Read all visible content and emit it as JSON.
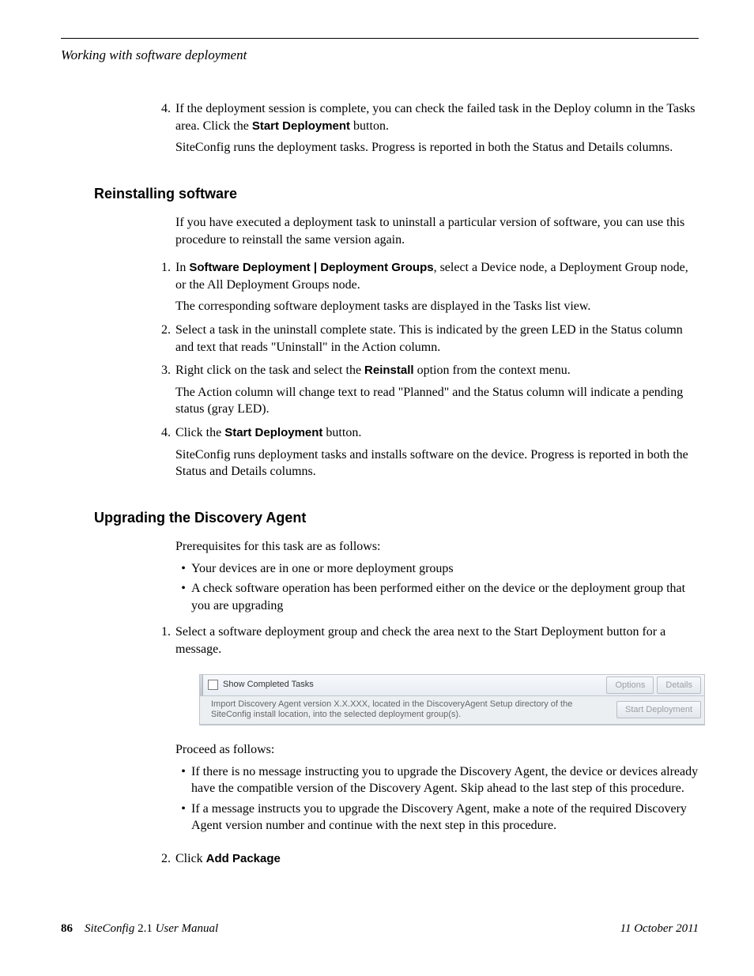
{
  "header": {
    "running_title": "Working with software deployment"
  },
  "section_a": {
    "step4_main": "If the deployment session is complete, you can check the failed task in the Deploy column in the Tasks area. Click the ",
    "step4_btn": "Start Deployment",
    "step4_tail": " button.",
    "step4_sub": "SiteConfig runs the deployment tasks. Progress is reported in both the Status and Details columns."
  },
  "reinstall": {
    "heading": "Reinstalling software",
    "intro": "If you have executed a deployment task to uninstall a particular version of software, you can use this procedure to reinstall the same version again.",
    "s1_pre": "In ",
    "s1_path": "Software Deployment | Deployment Groups",
    "s1_post": ", select a Device node, a Deployment Group node, or the All Deployment Groups node.",
    "s1_sub": "The corresponding software deployment tasks are displayed in the Tasks list view.",
    "s2": "Select a task in the uninstall complete state. This is indicated by the green LED in the Status column and text that reads \"Uninstall\" in the Action column.",
    "s3_pre": "Right click on the task and select the ",
    "s3_opt": "Reinstall",
    "s3_post": " option from the context menu.",
    "s3_sub": "The Action column will change text to read \"Planned\" and the Status column will indicate a pending status (gray LED).",
    "s4_pre": "Click the ",
    "s4_btn": "Start Deployment",
    "s4_post": " button.",
    "s4_sub": "SiteConfig runs deployment tasks and installs software on the device. Progress is reported in both the Status and Details columns."
  },
  "upgrade": {
    "heading": "Upgrading the Discovery Agent",
    "intro": "Prerequisites for this task are as follows:",
    "pre_b1": "Your devices are in one or more deployment groups",
    "pre_b2": "A check software operation has been performed either on the device or the deployment group that you are upgrading",
    "s1": "Select a software deployment group and check the area next to the Start Deployment button for a message.",
    "panel": {
      "show_completed": "Show Completed Tasks",
      "options": "Options",
      "details": "Details",
      "msg": "Import Discovery Agent version X.X.XXX, located in the DiscoveryAgent Setup directory of the SiteConfig install location, into the selected deployment group(s).",
      "start": "Start Deployment"
    },
    "proceed": "Proceed as follows:",
    "post_b1": "If there is no message instructing you to upgrade the Discovery Agent, the device or devices already have the compatible version of the Discovery Agent. Skip ahead to the last step of this procedure.",
    "post_b2": "If a message instructs you to upgrade the Discovery Agent, make a note of the required Discovery Agent version number and continue with the next step in this procedure.",
    "s2_pre": "Click ",
    "s2_btn": "Add Package"
  },
  "footer": {
    "page_number": "86",
    "product": "SiteConfig",
    "version": " 2.1 ",
    "doc": "User Manual",
    "date": "11 October 2011"
  }
}
